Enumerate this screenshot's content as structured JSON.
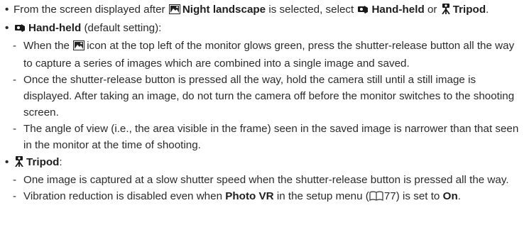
{
  "bullet1": {
    "p1": "From the screen displayed after",
    "night_landscape": "Night landscape",
    "p2": "is selected, select",
    "hand_held": "Hand-held",
    "or": "or",
    "tripod": "Tripod",
    "end": "."
  },
  "bullet2": {
    "hand_held": "Hand-held",
    "rest": "(default setting):",
    "items": [
      {
        "p1": "When the",
        "p2": "icon at the top left of the monitor glows green, press the shutter-release button all the way to capture a series of images which are combined into a single image and saved."
      },
      {
        "text": "Once the shutter-release button is pressed all the way, hold the camera still until a still image is displayed. After taking an image, do not turn the camera off before the monitor switches to the shooting screen."
      },
      {
        "text": "The angle of view (i.e., the area visible in the frame) seen in the saved image is narrower than that seen in the monitor at the time of shooting."
      }
    ]
  },
  "bullet3": {
    "tripod": "Tripod",
    "colon": ":",
    "items": [
      {
        "text": "One image is captured at a slow shutter speed when the shutter-release button is pressed all the way."
      },
      {
        "p1": "Vibration reduction is disabled even when",
        "photo_vr": "Photo VR",
        "p2": "in the setup menu (",
        "page_ref": "77",
        "p3": ") is set to",
        "on": "On",
        "end": "."
      }
    ]
  },
  "icons": {
    "bullet": "•",
    "dash": "-",
    "night_landscape": "night-landscape-icon",
    "hand_held": "hand-held-icon",
    "tripod": "tripod-icon",
    "book": "book-reference-icon"
  }
}
